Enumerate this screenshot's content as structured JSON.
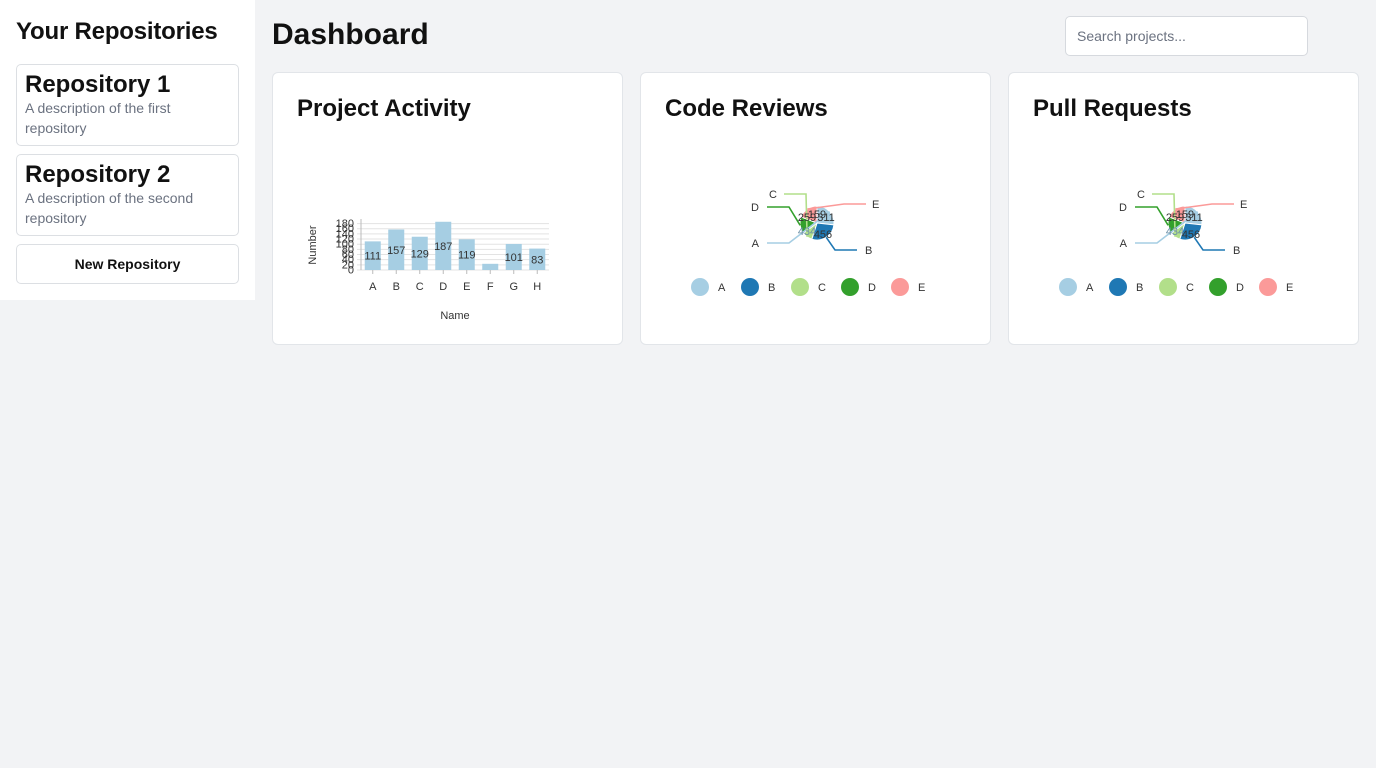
{
  "sidebar": {
    "title": "Your Repositories",
    "repositories": [
      {
        "name": "Repository 1",
        "description": "A description of the first repository"
      },
      {
        "name": "Repository 2",
        "description": "A description of the second repository"
      }
    ],
    "new_button_label": "New Repository"
  },
  "header": {
    "title": "Dashboard",
    "search_placeholder": "Search projects..."
  },
  "cards": [
    {
      "title": "Project Activity"
    },
    {
      "title": "Code Reviews"
    },
    {
      "title": "Pull Requests"
    }
  ],
  "chart_data": [
    {
      "type": "bar",
      "title": "Project Activity",
      "xlabel": "Name",
      "ylabel": "Number",
      "categories": [
        "A",
        "B",
        "C",
        "D",
        "E",
        "F",
        "G",
        "H"
      ],
      "values": [
        111,
        157,
        129,
        187,
        119,
        24,
        101,
        83
      ],
      "data_labels": [
        "111",
        "157",
        "129",
        "187",
        "119",
        "",
        "101",
        "83"
      ],
      "yticks": [
        "0",
        "20",
        "40",
        "60",
        "80",
        "100",
        "120",
        "140",
        "160",
        "180"
      ],
      "ylim": [
        0,
        190
      ],
      "grid": true,
      "color": "#a6cee3"
    },
    {
      "type": "pie",
      "title": "Code Reviews",
      "labels": [
        "A",
        "B",
        "C",
        "D",
        "E"
      ],
      "values": [
        434,
        456,
        159,
        259,
        311
      ],
      "value_labels": [
        "434",
        "456",
        "159",
        "259",
        "311"
      ],
      "colors": [
        "#a6cee3",
        "#1f78b4",
        "#b2df8a",
        "#33a02c",
        "#fb9a99"
      ],
      "legend": "bottom"
    },
    {
      "type": "pie",
      "title": "Pull Requests",
      "labels": [
        "A",
        "B",
        "C",
        "D",
        "E"
      ],
      "values": [
        434,
        456,
        159,
        259,
        311
      ],
      "value_labels": [
        "434",
        "456",
        "159",
        "259",
        "311"
      ],
      "colors": [
        "#a6cee3",
        "#1f78b4",
        "#b2df8a",
        "#33a02c",
        "#fb9a99"
      ],
      "legend": "bottom"
    }
  ]
}
